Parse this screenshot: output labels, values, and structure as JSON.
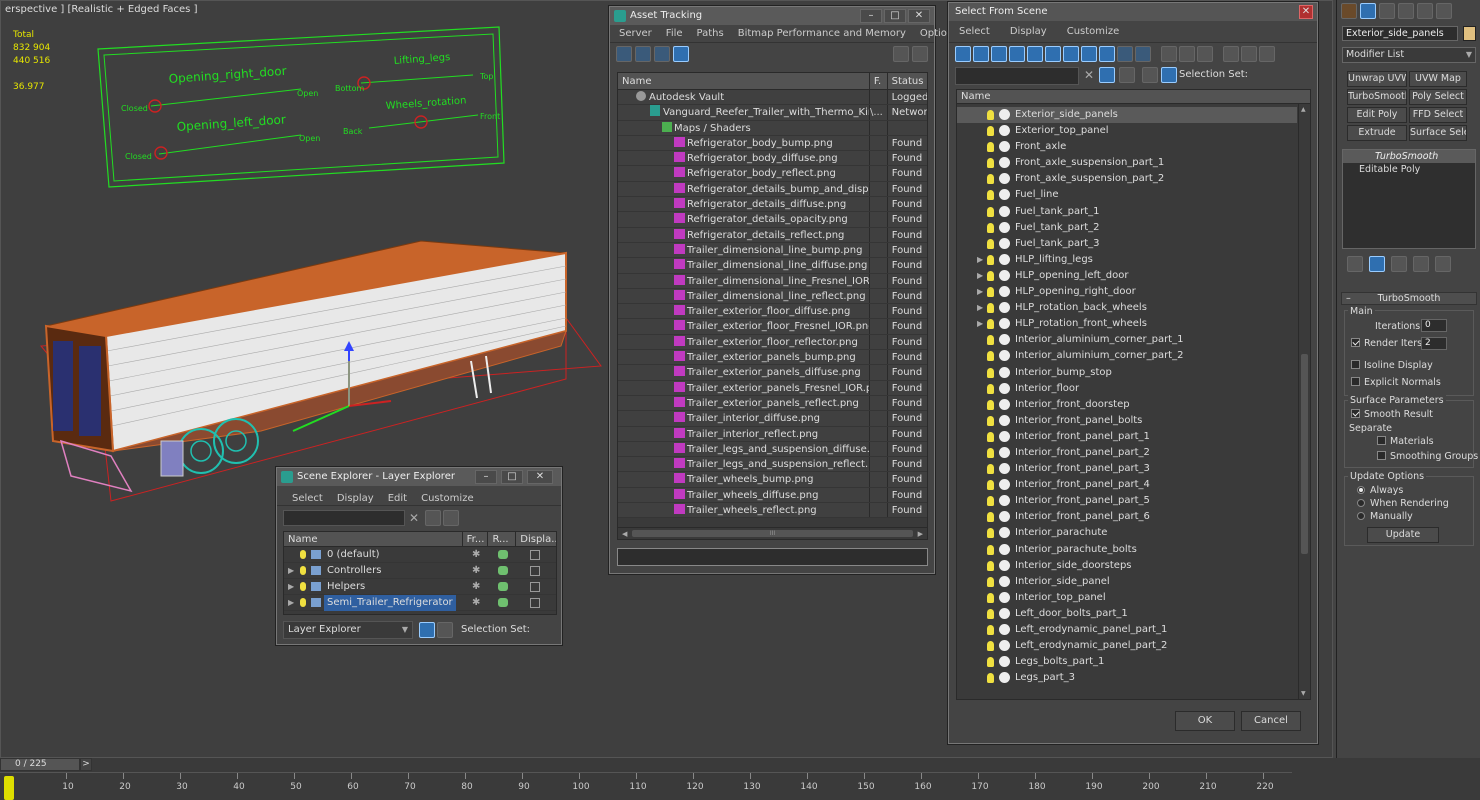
{
  "viewport": {
    "label": "erspective ] [Realistic + Edged Faces ]",
    "stats": {
      "total_label": "Total",
      "polys": "832 904",
      "verts": "440 516",
      "fps": "36.977"
    },
    "controller_labels": {
      "opening_right_door": "Opening_right_door",
      "opening_left_door": "Opening_left_door",
      "lifting_legs": "Lifting_legs",
      "wheels_rotation": "Wheels_rotation",
      "closed1": "Closed",
      "closed2": "Closed",
      "open1": "Open",
      "open2": "Open",
      "bottom": "Bottom",
      "top": "Top",
      "back": "Back",
      "front": "Front"
    },
    "colors": {
      "trailer_orange": "#c8642a",
      "wire_white": "#e8e8e8",
      "green": "#22dd22",
      "red": "#cc2222",
      "cyan": "#20c0b0",
      "pink": "#e080c0"
    }
  },
  "asset_tracking": {
    "title": "Asset Tracking",
    "menu": [
      "Server",
      "File",
      "Paths",
      "Bitmap Performance and Memory",
      "Options"
    ],
    "columns": [
      "Name",
      "F.",
      "Status"
    ],
    "rows": [
      {
        "name": "Autodesk Vault",
        "f": "",
        "status": "Logged",
        "icon": "vault-icon",
        "indent": 1
      },
      {
        "name": "Vanguard_Reefer_Trailer_with_Thermo_King_C...",
        "f": "\\...",
        "status": "Network",
        "icon": "max-file-icon",
        "indent": 2
      },
      {
        "name": "Maps / Shaders",
        "f": "",
        "status": "",
        "icon": "folder-icon",
        "indent": 3
      },
      {
        "name": "Refrigerator_body_bump.png",
        "f": "",
        "status": "Found",
        "icon": "png-icon",
        "indent": 4
      },
      {
        "name": "Refrigerator_body_diffuse.png",
        "f": "",
        "status": "Found",
        "icon": "png-icon",
        "indent": 4
      },
      {
        "name": "Refrigerator_body_reflect.png",
        "f": "",
        "status": "Found",
        "icon": "png-icon",
        "indent": 4
      },
      {
        "name": "Refrigerator_details_bump_and_displace...",
        "f": "",
        "status": "Found",
        "icon": "png-icon",
        "indent": 4
      },
      {
        "name": "Refrigerator_details_diffuse.png",
        "f": "",
        "status": "Found",
        "icon": "png-icon",
        "indent": 4
      },
      {
        "name": "Refrigerator_details_opacity.png",
        "f": "",
        "status": "Found",
        "icon": "png-icon",
        "indent": 4
      },
      {
        "name": "Refrigerator_details_reflect.png",
        "f": "",
        "status": "Found",
        "icon": "png-icon",
        "indent": 4
      },
      {
        "name": "Trailer_dimensional_line_bump.png",
        "f": "",
        "status": "Found",
        "icon": "png-icon",
        "indent": 4
      },
      {
        "name": "Trailer_dimensional_line_diffuse.png",
        "f": "",
        "status": "Found",
        "icon": "png-icon",
        "indent": 4
      },
      {
        "name": "Trailer_dimensional_line_Fresnel_IOR.png",
        "f": "",
        "status": "Found",
        "icon": "png-icon",
        "indent": 4
      },
      {
        "name": "Trailer_dimensional_line_reflect.png",
        "f": "",
        "status": "Found",
        "icon": "png-icon",
        "indent": 4
      },
      {
        "name": "Trailer_exterior_floor_diffuse.png",
        "f": "",
        "status": "Found",
        "icon": "png-icon",
        "indent": 4
      },
      {
        "name": "Trailer_exterior_floor_Fresnel_IOR.png",
        "f": "",
        "status": "Found",
        "icon": "png-icon",
        "indent": 4
      },
      {
        "name": "Trailer_exterior_floor_reflector.png",
        "f": "",
        "status": "Found",
        "icon": "png-icon",
        "indent": 4
      },
      {
        "name": "Trailer_exterior_panels_bump.png",
        "f": "",
        "status": "Found",
        "icon": "png-icon",
        "indent": 4
      },
      {
        "name": "Trailer_exterior_panels_diffuse.png",
        "f": "",
        "status": "Found",
        "icon": "png-icon",
        "indent": 4
      },
      {
        "name": "Trailer_exterior_panels_Fresnel_IOR.png",
        "f": "",
        "status": "Found",
        "icon": "png-icon",
        "indent": 4
      },
      {
        "name": "Trailer_exterior_panels_reflect.png",
        "f": "",
        "status": "Found",
        "icon": "png-icon",
        "indent": 4
      },
      {
        "name": "Trailer_interior_diffuse.png",
        "f": "",
        "status": "Found",
        "icon": "png-icon",
        "indent": 4
      },
      {
        "name": "Trailer_interior_reflect.png",
        "f": "",
        "status": "Found",
        "icon": "png-icon",
        "indent": 4
      },
      {
        "name": "Trailer_legs_and_suspension_diffuse.png",
        "f": "",
        "status": "Found",
        "icon": "png-icon",
        "indent": 4
      },
      {
        "name": "Trailer_legs_and_suspension_reflect.png",
        "f": "",
        "status": "Found",
        "icon": "png-icon",
        "indent": 4
      },
      {
        "name": "Trailer_wheels_bump.png",
        "f": "",
        "status": "Found",
        "icon": "png-icon",
        "indent": 4
      },
      {
        "name": "Trailer_wheels_diffuse.png",
        "f": "",
        "status": "Found",
        "icon": "png-icon",
        "indent": 4
      },
      {
        "name": "Trailer_wheels_reflect.png",
        "f": "",
        "status": "Found",
        "icon": "png-icon",
        "indent": 4
      }
    ],
    "scroll_grip": "III"
  },
  "select_from_scene": {
    "title": "Select From Scene",
    "menu": [
      "Select",
      "Display",
      "Customize"
    ],
    "selection_set_label": "Selection Set:",
    "column_name": "Name",
    "items": [
      {
        "label": "Exterior_side_panels",
        "expandable": false,
        "highlight": true
      },
      {
        "label": "Exterior_top_panel",
        "expandable": false
      },
      {
        "label": "Front_axle",
        "expandable": false
      },
      {
        "label": "Front_axle_suspension_part_1",
        "expandable": false
      },
      {
        "label": "Front_axle_suspension_part_2",
        "expandable": false
      },
      {
        "label": "Fuel_line",
        "expandable": false
      },
      {
        "label": "Fuel_tank_part_1",
        "expandable": false
      },
      {
        "label": "Fuel_tank_part_2",
        "expandable": false
      },
      {
        "label": "Fuel_tank_part_3",
        "expandable": false
      },
      {
        "label": "HLP_lifting_legs",
        "expandable": true
      },
      {
        "label": "HLP_opening_left_door",
        "expandable": true
      },
      {
        "label": "HLP_opening_right_door",
        "expandable": true
      },
      {
        "label": "HLP_rotation_back_wheels",
        "expandable": true
      },
      {
        "label": "HLP_rotation_front_wheels",
        "expandable": true
      },
      {
        "label": "Interior_aluminium_corner_part_1",
        "expandable": false
      },
      {
        "label": "Interior_aluminium_corner_part_2",
        "expandable": false
      },
      {
        "label": "Interior_bump_stop",
        "expandable": false
      },
      {
        "label": "Interior_floor",
        "expandable": false
      },
      {
        "label": "Interior_front_doorstep",
        "expandable": false
      },
      {
        "label": "Interior_front_panel_bolts",
        "expandable": false
      },
      {
        "label": "Interior_front_panel_part_1",
        "expandable": false
      },
      {
        "label": "Interior_front_panel_part_2",
        "expandable": false
      },
      {
        "label": "Interior_front_panel_part_3",
        "expandable": false
      },
      {
        "label": "Interior_front_panel_part_4",
        "expandable": false
      },
      {
        "label": "Interior_front_panel_part_5",
        "expandable": false
      },
      {
        "label": "Interior_front_panel_part_6",
        "expandable": false
      },
      {
        "label": "Interior_parachute",
        "expandable": false
      },
      {
        "label": "Interior_parachute_bolts",
        "expandable": false
      },
      {
        "label": "Interior_side_doorsteps",
        "expandable": false
      },
      {
        "label": "Interior_side_panel",
        "expandable": false
      },
      {
        "label": "Interior_top_panel",
        "expandable": false
      },
      {
        "label": "Left_door_bolts_part_1",
        "expandable": false
      },
      {
        "label": "Left_erodynamic_panel_part_1",
        "expandable": false
      },
      {
        "label": "Left_erodynamic_panel_part_2",
        "expandable": false
      },
      {
        "label": "Legs_bolts_part_1",
        "expandable": false
      },
      {
        "label": "Legs_part_3",
        "expandable": false
      }
    ],
    "ok_label": "OK",
    "cancel_label": "Cancel"
  },
  "scene_explorer": {
    "title": "Scene Explorer - Layer Explorer",
    "menu": [
      "Select",
      "Display",
      "Edit",
      "Customize"
    ],
    "columns": [
      "Name",
      "Fr...",
      "R...",
      "Displa..."
    ],
    "layers": [
      {
        "label": "0 (default)",
        "expandable": false,
        "selected": false
      },
      {
        "label": "Controllers",
        "expandable": true,
        "selected": false
      },
      {
        "label": "Helpers",
        "expandable": true,
        "selected": false
      },
      {
        "label": "Semi_Trailer_Refrigerator",
        "expandable": true,
        "selected": true
      }
    ],
    "explorer_dropdown": "Layer Explorer",
    "selection_set_label": "Selection Set:"
  },
  "command_panel": {
    "object_name": "Exterior_side_panels",
    "object_color": "#e0c080",
    "modifier_list_label": "Modifier List",
    "buttons": [
      "Unwrap UVW",
      "UVW Map",
      "TurboSmooth",
      "Poly Select",
      "Edit Poly",
      "FFD Select",
      "Extrude",
      "Surface Select"
    ],
    "stack": [
      "TurboSmooth",
      "Editable Poly"
    ],
    "rollout_title": "TurboSmooth",
    "main_label": "Main",
    "iterations_label": "Iterations:",
    "iterations_value": "0",
    "render_iters_label": "Render Iters:",
    "render_iters_value": "2",
    "render_iters_checked": true,
    "isoline_label": "Isoline Display",
    "explicit_normals_label": "Explicit Normals",
    "surface_params_label": "Surface Parameters",
    "smooth_result_label": "Smooth Result",
    "separate_label": "Separate",
    "materials_label": "Materials",
    "smoothing_groups_label": "Smoothing Groups",
    "update_options_label": "Update Options",
    "always_label": "Always",
    "when_rendering_label": "When Rendering",
    "manually_label": "Manually",
    "update_button": "Update"
  },
  "timeline": {
    "frame_counter": "0 / 225",
    "next_label": ">",
    "ticks": [
      "10",
      "20",
      "30",
      "40",
      "50",
      "60",
      "70",
      "80",
      "90",
      "100",
      "110",
      "120",
      "130",
      "140",
      "150",
      "160",
      "170",
      "180",
      "190",
      "200",
      "210",
      "220"
    ]
  }
}
